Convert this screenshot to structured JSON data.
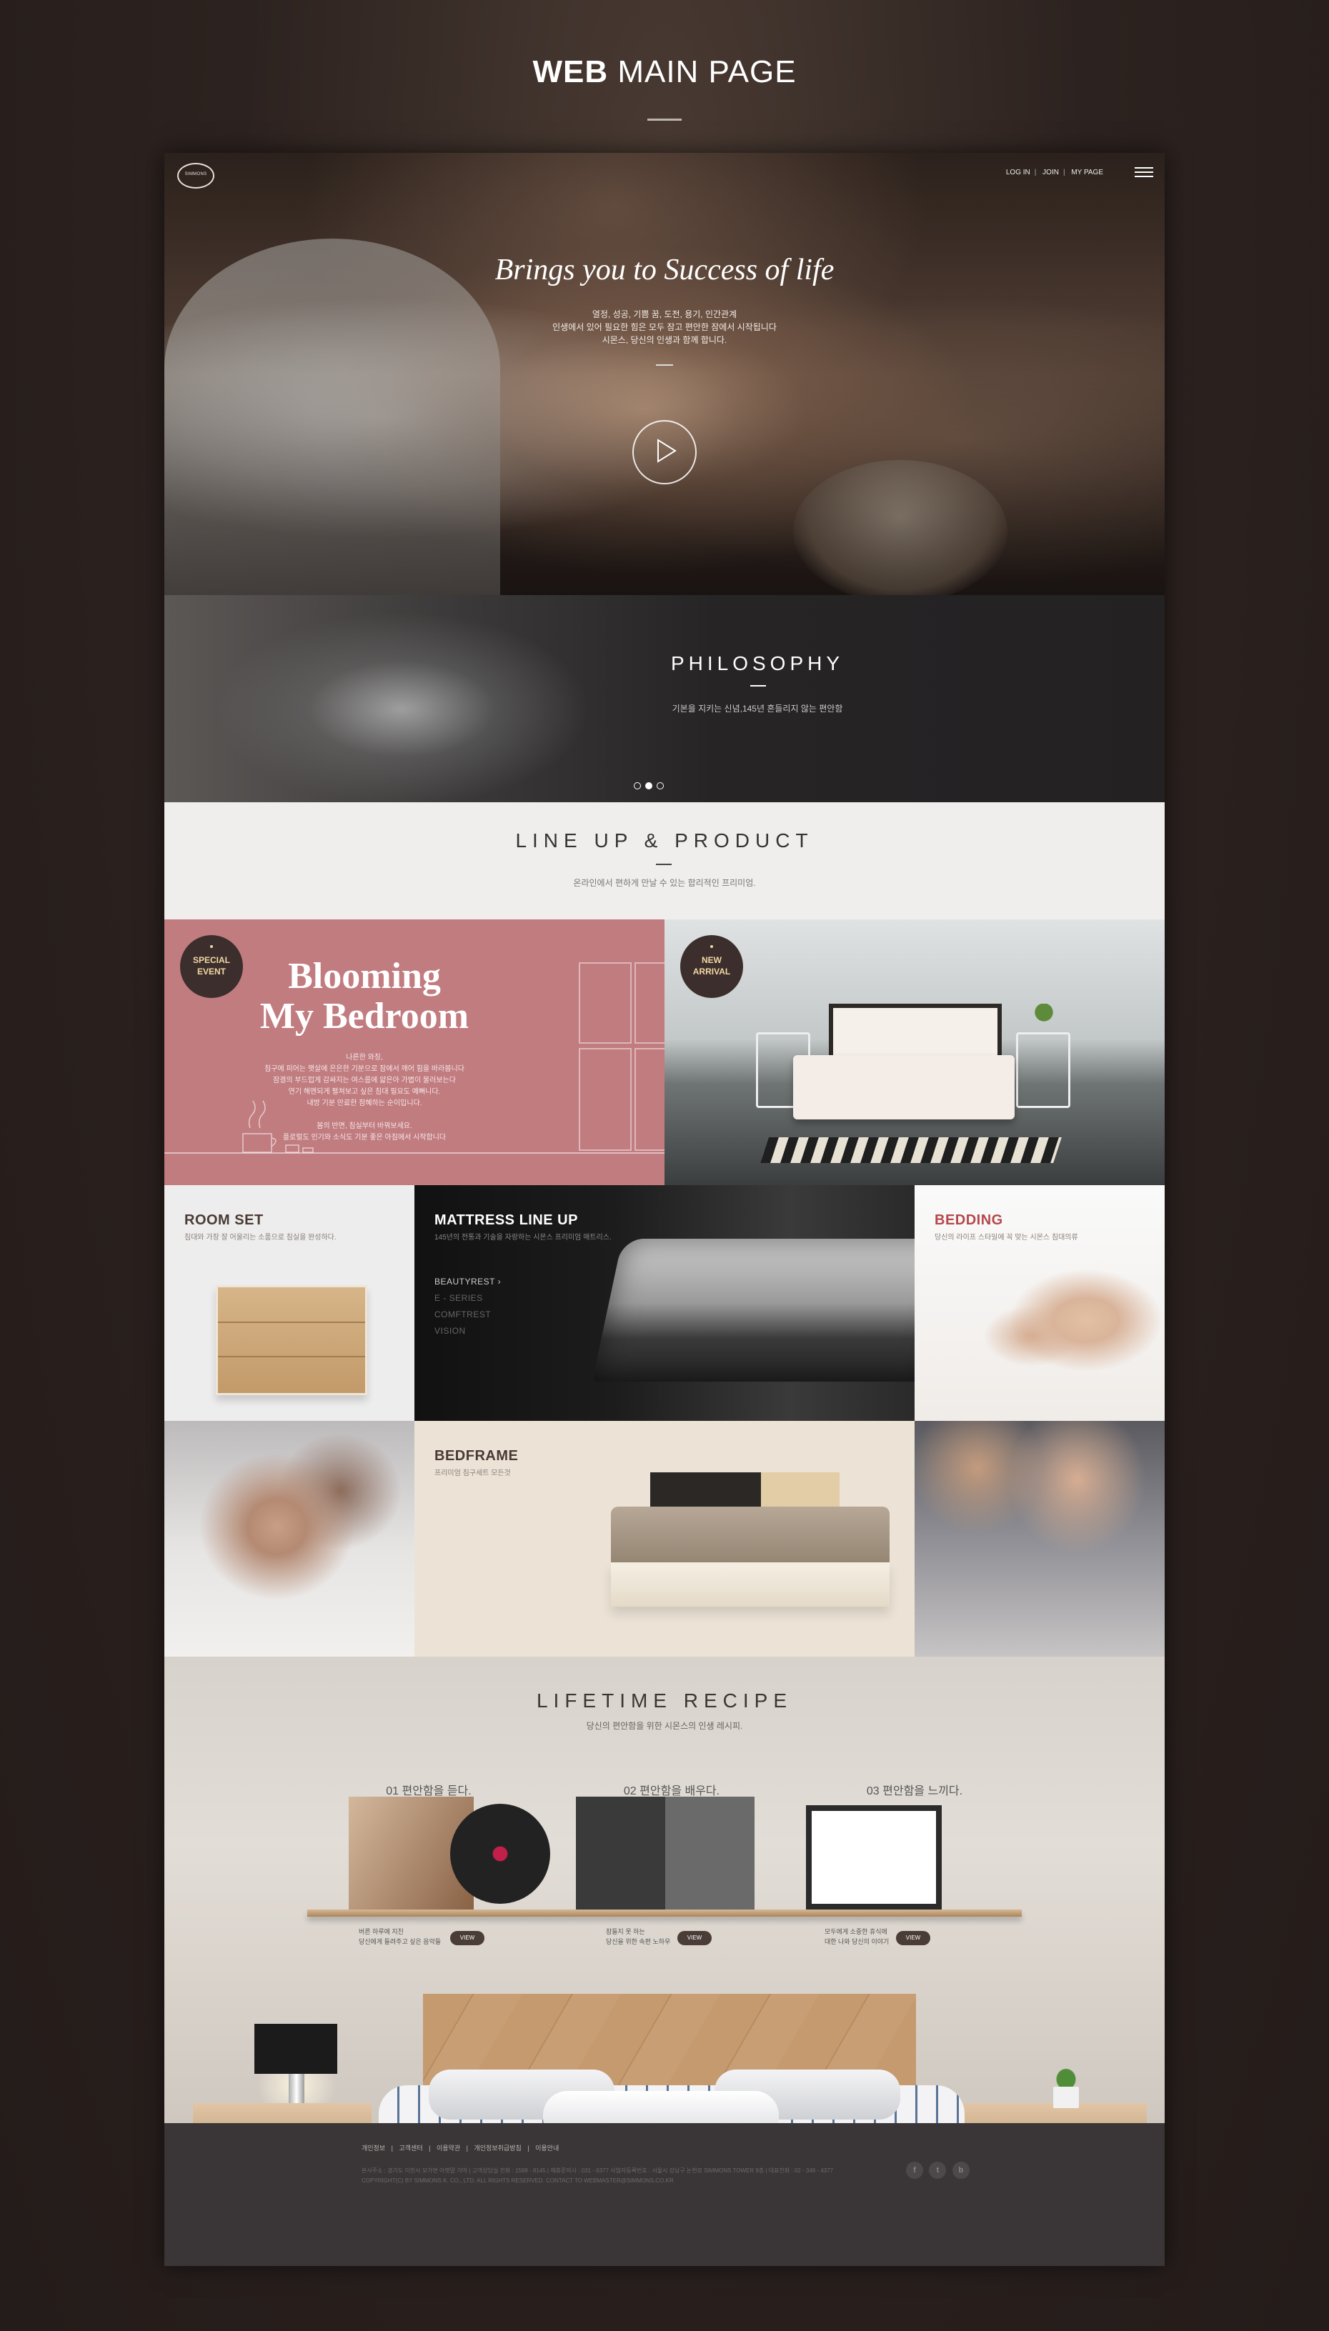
{
  "page_heading": {
    "bold": "WEB",
    "light": "MAIN PAGE"
  },
  "header": {
    "logo_text": "SIMMONS",
    "links": [
      "LOG IN",
      "JOIN",
      "MY PAGE"
    ]
  },
  "hero": {
    "title": "Brings you to Success of life",
    "lines": [
      "열정, 성공, 기쁨 꿈, 도전, 용기, 인간관계",
      "인생에서 있어 필요한 힘은 모두 잠고 편안한 잠에서 시작됩니다",
      "시몬스, 당신의 인생과 함께 합니다."
    ]
  },
  "philosophy": {
    "title": "PHILOSOPHY",
    "subtitle": "기본을 지키는 신념,145년 흔들리지 않는 편안함"
  },
  "lineup": {
    "title": "LINE UP & PRODUCT",
    "subtitle": "온라인에서 편하게 만날 수 있는 합리적인 프리미엄."
  },
  "promo": {
    "special_event": [
      "SPECIAL",
      "EVENT"
    ],
    "new_arrival": [
      "NEW",
      "ARRIVAL"
    ],
    "bloom_title": [
      "Blooming",
      "My Bedroom"
    ],
    "bloom_text": [
      "나른한 와칭,",
      "침구에 피어는 햇살에 은은한 기분으로 잠에서 깨어 힘을 바라봅니다",
      "잠결의 부드럽게 감싸지는 여스름에 얇은아 가볍이 불러보는다",
      "연기 해엔되게 펼쳐보고 싶은 침대 필요도 예뻐니다.",
      "내방 기분 만료한 잠혜하는 순이입니다.",
      "",
      "봄의 반면, 침실부터 바꿔보세요.",
      "플로럴도 인기와 소식도 기분 좋은 아침에서 시작합니다"
    ]
  },
  "grid": {
    "roomset": {
      "title": "ROOM SET",
      "subtitle": "침대와 가장 잘 어울리는 소품으로 침실을 완성하다."
    },
    "mattress": {
      "title": "MATTRESS LINE UP",
      "subtitle": "145년의 전통과 기술을 자랑하는 시몬스 프리미엄 매트리스.",
      "items": [
        "BEAUTYREST  ›",
        "E - SERIES",
        "COMFTREST",
        "VISION"
      ]
    },
    "bedding": {
      "title": "BEDDING",
      "subtitle": "당신의 라이프 스타일에 꼭 맞는 시몬스 침대의류"
    },
    "bedframe": {
      "title": "BEDFRAME",
      "subtitle": "프리미엄 침구세트 모든것"
    }
  },
  "recipe": {
    "title": "LIFETIME RECIPE",
    "subtitle": "당신의 편안함을 위한 시몬스의 인생 레시피.",
    "steps": [
      {
        "title": "01 편안함을 듣다.",
        "desc": [
          "버른 하루에 지친",
          "당신에게 들려주고 싶은 음악들"
        ],
        "button": "VIEW"
      },
      {
        "title": "02 편안함을 배우다.",
        "desc": [
          "잠들지 못 하는",
          "당신을 위한 속편 노하우"
        ],
        "button": "VIEW"
      },
      {
        "title": "03 편안함을 느끼다.",
        "desc": [
          "모두에게 소중한 휴식에",
          "대한 나와 당신의 이야기"
        ],
        "button": "VIEW"
      }
    ]
  },
  "footer": {
    "links": [
      "개인정보",
      "|",
      "고객센터",
      "|",
      "이용약관",
      "|",
      "개인정보취급방침",
      "|",
      "이용안내"
    ],
    "info": [
      "본사주소 : 경기도 이천시 모가면 아랫말 가마 | 고객상담실 전화 : 1588 - 8145 | 제휴문의사 : 031 - 6377 사업자등록번호 : 서울시 강남구 논현로 SIMMONS TOWER 9층 | 대표전화 : 02 - 349 - 4377",
      "COPYRIGHT(C) BY SIMMONS K. CO., LTD. ALL RIGHTS RESERVED. CONTACT TO WEBMASTER@SIMMONS.CO.KR"
    ],
    "social": [
      "f",
      "t",
      "b"
    ]
  }
}
